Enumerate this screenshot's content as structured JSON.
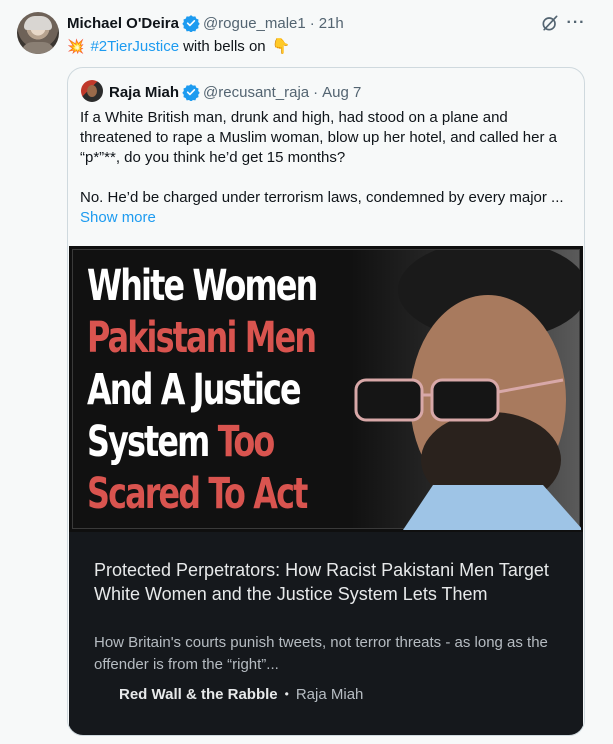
{
  "tweet": {
    "name": "Michael O'Deira",
    "handle": "@rogue_male1",
    "separator": "·",
    "time": "21h",
    "burst_emoji": "💥",
    "hashtag": "#2TierJustice",
    "text_rest": "with bells on",
    "pointing_emoji": "👇"
  },
  "quote": {
    "name": "Raja Miah",
    "handle": "@recusant_raja",
    "separator": "·",
    "time": "Aug 7",
    "lines": [
      "If a White British man, drunk and high, had stood on a plane and",
      "threatened to rape a Muslim woman, blow up her hotel, and called her a",
      "“p*”**, do you think he’d get 15 months?",
      "No. He’d be charged under terrorism laws, condemned by every major ..."
    ],
    "show_more": "Show more"
  },
  "card": {
    "image_headline": {
      "line1": "White Women",
      "line2": "Pakistani Men",
      "line3": "And A Justice",
      "line4a": "System",
      "line4b": "Too",
      "line5": "Scared To Act"
    },
    "title": "Protected Perpetrators: How Racist Pakistani Men Target White Women and the Justice System Lets Them",
    "description": "How Britain's courts punish tweets, not terror threats - as long as the offender is from the “right”...",
    "publication": "Red Wall & the Rabble",
    "bullet": "•",
    "author": "Raja Miah"
  },
  "icons": {
    "verified": "verified-badge-icon",
    "grok": "grok-icon",
    "more": "more-icon"
  },
  "colors": {
    "accent": "#1d9bf0",
    "headline_red": "#d9544f",
    "card_bg": "#15181c",
    "burst": "#e0442e"
  }
}
